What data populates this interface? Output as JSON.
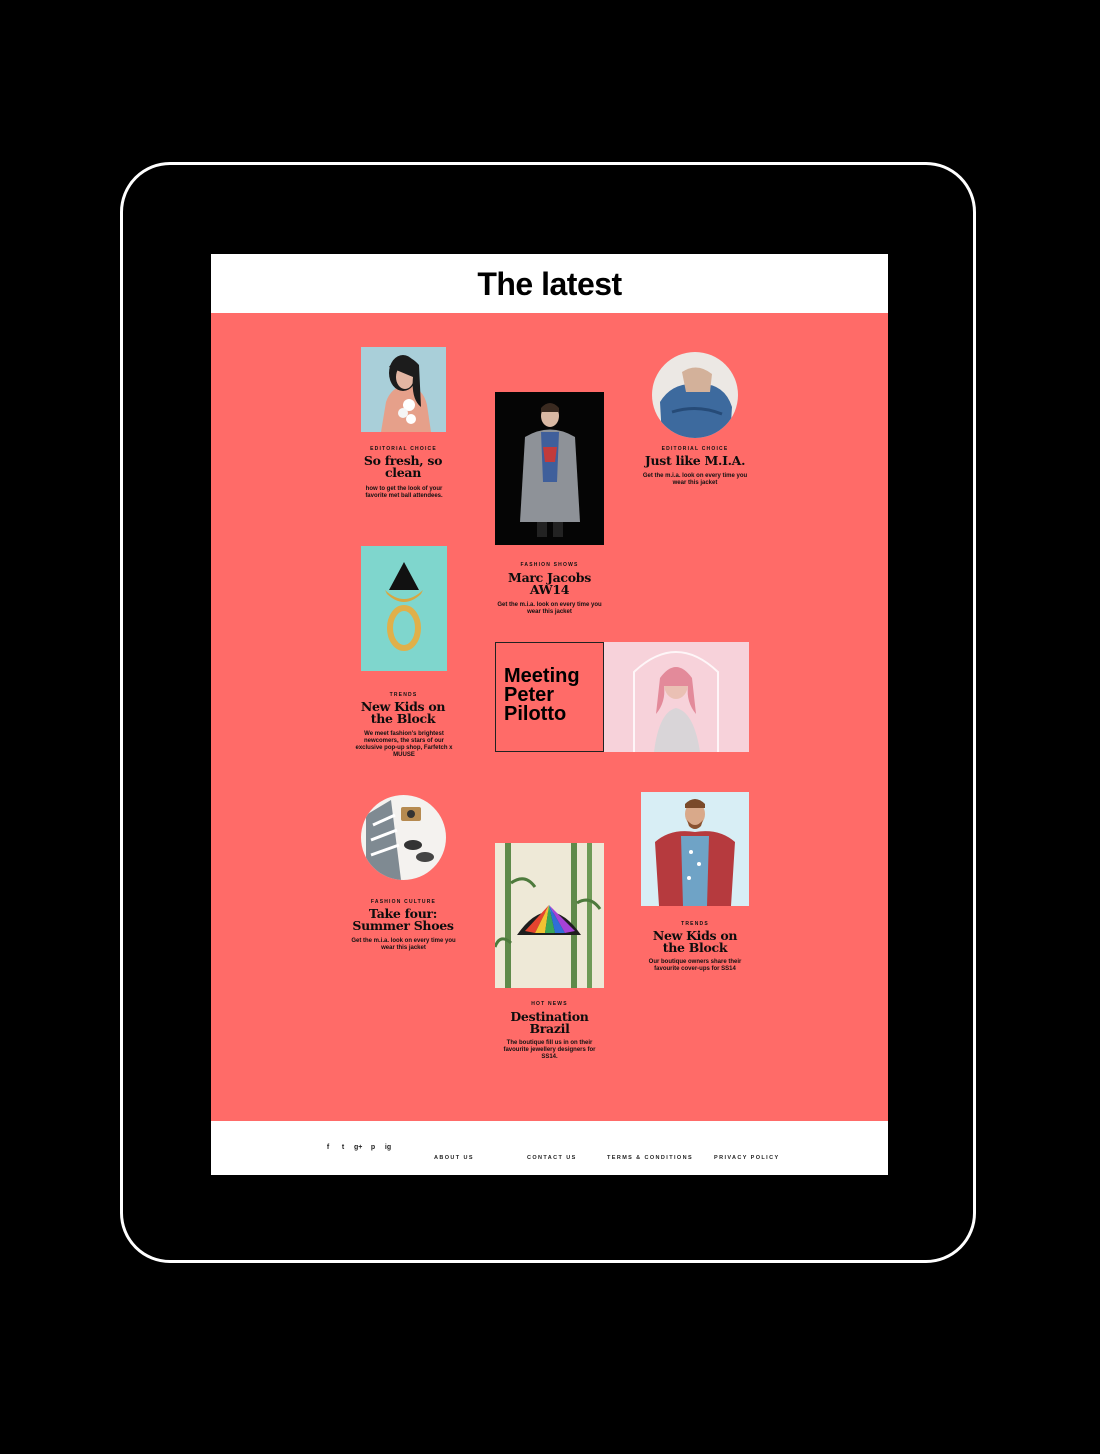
{
  "header": {
    "title": "The latest"
  },
  "cards": [
    {
      "category": "EDITORIAL CHOICE",
      "title": "So fresh, so clean",
      "desc": "how to get the look of your favorite met ball attendees."
    },
    {
      "category": "FASHION SHOWS",
      "title": "Marc Jacobs AW14",
      "desc": "Get the m.i.a. look on every time you wear this jacket"
    },
    {
      "category": "EDITORIAL CHOICE",
      "title": "Just like M.I.A.",
      "desc": "Get the m.i.a. look on every time you wear this jacket"
    },
    {
      "category": "TRENDS",
      "title": "New Kids on the Block",
      "desc": "We meet fashion's brightest newcomers, the stars of our exclusive pop-up shop, Farfetch x MUUSE"
    },
    {
      "category": "FASHION CULTURE",
      "title": "Take four: Summer Shoes",
      "desc": "Get the m.i.a. look on every time you wear this jacket"
    },
    {
      "category": "HOT NEWS",
      "title": "Destination Brazil",
      "desc": "The boutique fill us in on their favourite jewellery designers for SS14."
    },
    {
      "category": "TRENDS",
      "title": "New Kids on the Block",
      "desc": "Our boutique owners share their favourite cover-ups for SS14"
    }
  ],
  "feature": {
    "title": "Meeting Peter Pilotto"
  },
  "footer": {
    "social": [
      "f",
      "t",
      "g+",
      "p",
      "ig"
    ],
    "links": [
      "ABOUT US",
      "CONTACT US",
      "TERMS & CONDITIONS",
      "PRIVACY POLICY"
    ]
  },
  "colors": {
    "accent": "#ff6b68",
    "frame": "#000000",
    "header": "#ffffff"
  }
}
